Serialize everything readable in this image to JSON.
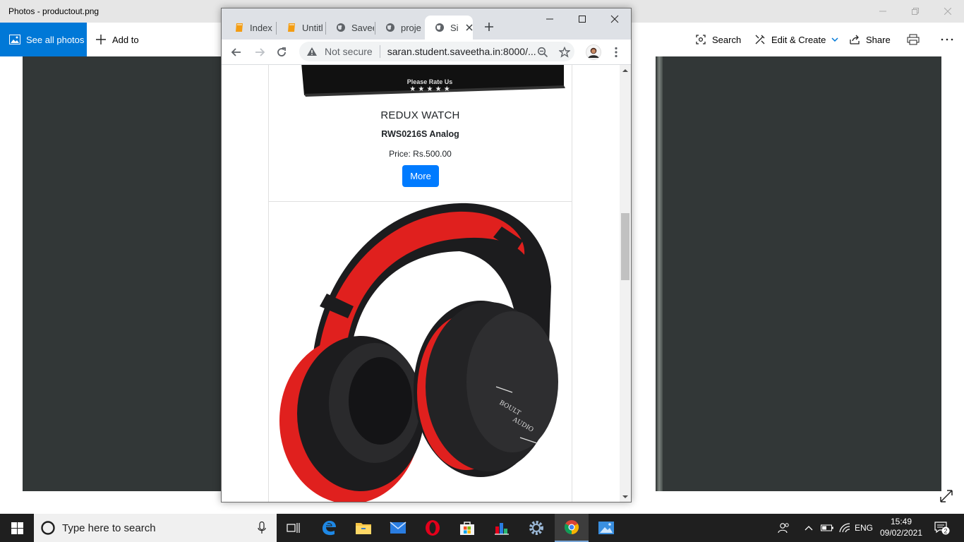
{
  "photos": {
    "window_title": "Photos - productout.png",
    "see_all_label": "See all photos",
    "add_to_label": "Add to",
    "search_label": "Search",
    "edit_create_label": "Edit & Create",
    "share_label": "Share"
  },
  "chrome": {
    "tabs": [
      {
        "label": "Index",
        "icon": "orange-doc-icon"
      },
      {
        "label": "Untitl",
        "icon": "orange-doc-icon"
      },
      {
        "label": "Savee",
        "icon": "globe-icon"
      },
      {
        "label": "proje",
        "icon": "globe-icon"
      },
      {
        "label": "Si",
        "icon": "globe-icon",
        "active": true
      }
    ],
    "security_label": "Not secure",
    "url": "saran.student.saveetha.in:8000/..."
  },
  "page": {
    "product1": {
      "box_text": "Please Rate Us",
      "stars": "★ ★ ★ ★ ★",
      "name": "REDUX WATCH",
      "model": "RWS0216S Analog",
      "price": "Price: Rs.500.00",
      "button": "More"
    },
    "product2": {
      "brand_line1": "BOULT",
      "brand_line2": "AUDIO"
    }
  },
  "taskbar": {
    "search_placeholder": "Type here to search",
    "language": "ENG",
    "time": "15:49",
    "date": "09/02/2021",
    "notification_count": "2"
  },
  "colors": {
    "accent": "#0078d7",
    "button": "#007bff",
    "canvas": "#323737",
    "headphone_red": "#e0201e",
    "headphone_black": "#1c1c1e"
  }
}
